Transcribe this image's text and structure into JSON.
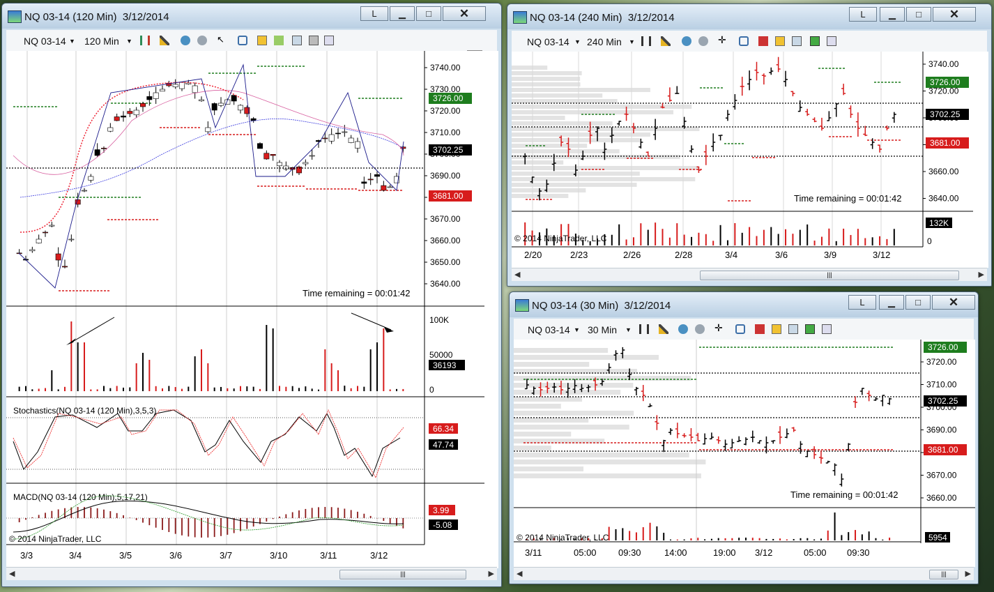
{
  "left": {
    "title": "NQ 03-14 (120 Min)  3/12/2014",
    "toolbar": {
      "instrument": "NQ 03-14",
      "interval": "120 Min"
    },
    "minimize_label": "L",
    "time_remaining": "Time remaining = 00:01:42",
    "copyright_vol": "",
    "copyright_macd": "© 2014 NinjaTrader, LLC",
    "price_ticks": [
      "3740.00",
      "3730.00",
      "3720.00",
      "3710.00",
      "3700.00",
      "3690.00",
      "3680.00",
      "3670.00",
      "3660.00",
      "3650.00",
      "3640.00"
    ],
    "price_badges": {
      "green": "3726.00",
      "current": "3702.25",
      "red": "3681.00"
    },
    "volume_ticks": [
      "100K",
      "50000",
      "0"
    ],
    "volume_badge": "36193",
    "stoch_title": "Stochastics(NQ 03-14 (120 Min),3,5,3)",
    "stoch_badges": {
      "red": "66.34",
      "black": "47.74"
    },
    "macd_title": "MACD(NQ 03-14 (120 Min),5,17,21)",
    "macd_badges": {
      "red": "3.99",
      "black": "-5.08"
    },
    "dates": [
      "3/3",
      "3/4",
      "3/5",
      "3/6",
      "3/7",
      "3/10",
      "3/11",
      "3/12"
    ],
    "scroll_grip": "|||"
  },
  "top_right": {
    "title": "NQ 03-14 (240 Min)  3/12/2014",
    "toolbar": {
      "instrument": "NQ 03-14",
      "interval": "240 Min"
    },
    "minimize_label": "L",
    "time_remaining": "Time remaining = 00:01:42",
    "copyright": "© 2014 NinjaTrader, LLC",
    "price_ticks": [
      "3740.00",
      "3720.00",
      "3700.00",
      "3680.00",
      "3660.00",
      "3640.00"
    ],
    "price_badges": {
      "green": "3726.00",
      "current": "3702.25",
      "red": "3681.00"
    },
    "volume_badge": "132K",
    "volume_zero": "0",
    "dates": [
      "2/20",
      "2/23",
      "2/26",
      "2/28",
      "3/4",
      "3/6",
      "3/9",
      "3/12"
    ],
    "scroll_grip": "|||"
  },
  "bottom_right": {
    "title": "NQ 03-14 (30 Min)  3/12/2014",
    "toolbar": {
      "instrument": "NQ 03-14",
      "interval": "30 Min"
    },
    "minimize_label": "L",
    "time_remaining": "Time remaining = 00:01:42",
    "copyright": "© 2014 NinjaTrader, LLC",
    "price_ticks": [
      "3720.00",
      "3710.00",
      "3700.00",
      "3690.00",
      "3680.00",
      "3670.00",
      "3660.00"
    ],
    "price_badges": {
      "green": "3726.00",
      "current": "3702.25",
      "red": "3681.00"
    },
    "volume_badge": "5954",
    "times": [
      "3/11",
      "05:00",
      "09:30",
      "14:00",
      "19:00",
      "3/12",
      "05:00",
      "09:30"
    ],
    "scroll_grip": "|||"
  },
  "colors": {
    "up": "#000000",
    "down": "#d71c1c",
    "green_level": "#1e7d1e",
    "red_level": "#d71c1c",
    "badge_green": "#1e7d1e",
    "badge_red": "#d71c1c",
    "badge_black": "#000000"
  },
  "icons": [
    "chart-window-icon",
    "bars-style-icon",
    "pencil-icon",
    "add-indicator-icon",
    "strategy-icon",
    "pointer-icon",
    "zoom-icon",
    "chart-properties-icon"
  ]
}
